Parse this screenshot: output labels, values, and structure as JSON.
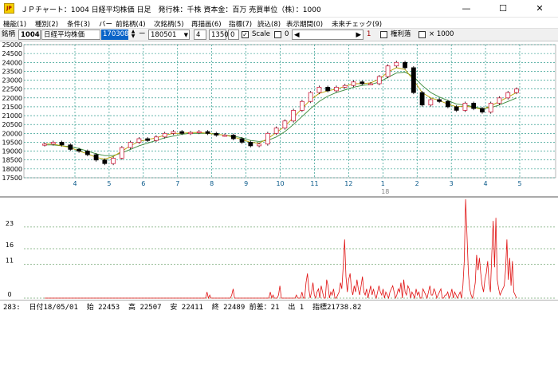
{
  "window": {
    "icon_text": "JP",
    "title": "ＪＰチャート：1004 日経平均株価 日足　発行株：千株 資本金：百万 売買単位（株）：1000",
    "min_glyph": "—",
    "max_glyph": "☐",
    "close_glyph": "✕"
  },
  "menu": [
    {
      "label": "機能(1)"
    },
    {
      "label": "種別(2)"
    },
    {
      "label": "条件(3)"
    },
    {
      "label": "バー"
    },
    {
      "label": "前銘柄(4)"
    },
    {
      "label": "次銘柄(5)"
    },
    {
      "label": "再描画(6)"
    },
    {
      "label": "指標(7)"
    },
    {
      "label": "読込(8)"
    },
    {
      "label": "表示期間(0)"
    },
    {
      "label": "未来チェック(9)"
    }
  ],
  "toolbar": {
    "label_code": "銘柄",
    "code_value": "1004",
    "name_value": "日経平均株価",
    "date_value": "170308",
    "dash": "ー",
    "end_date_value": "180501",
    "period_value": "4",
    "count_value": "1350",
    "zero_value": "0",
    "scale_label": "Scale",
    "scale_value": "0",
    "page_value": "1",
    "dividend_label": "権利落",
    "multiplier_label": "× 1000"
  },
  "chart_data": {
    "type": "candlestick",
    "price_axis": {
      "ticks": [
        25000,
        24500,
        24000,
        23500,
        23000,
        22500,
        22000,
        21500,
        21000,
        20500,
        20000,
        19500,
        19000,
        18500,
        18000,
        17500
      ],
      "range": [
        17500,
        25000
      ]
    },
    "months": [
      "4",
      "5",
      "6",
      "7",
      "8",
      "9",
      "10",
      "11",
      "12",
      "1",
      "2",
      "3",
      "4",
      "5"
    ],
    "year_label": "18",
    "close": [
      19400,
      19500,
      19350,
      19100,
      19000,
      18800,
      18500,
      18300,
      18600,
      19200,
      19500,
      19700,
      19600,
      19800,
      20000,
      20100,
      20000,
      20050,
      20100,
      20000,
      19900,
      19900,
      19700,
      19500,
      19300,
      19400,
      20000,
      20300,
      20700,
      21300,
      21800,
      22300,
      22600,
      22400,
      22600,
      22700,
      22900,
      22800,
      22800,
      23200,
      23800,
      24000,
      23700,
      22300,
      21600,
      21900,
      21800,
      21500,
      21300,
      21700,
      21400,
      21200,
      21700,
      22000,
      22300,
      22500
    ],
    "ma_short": [
      19400,
      19400,
      19300,
      19200,
      19000,
      18850,
      18650,
      18550,
      18700,
      19000,
      19300,
      19550,
      19650,
      19750,
      19900,
      20000,
      20000,
      20050,
      20050,
      20000,
      19950,
      19900,
      19800,
      19650,
      19500,
      19450,
      19700,
      20050,
      20400,
      20900,
      21400,
      21900,
      22250,
      22400,
      22500,
      22650,
      22800,
      22800,
      22850,
      23050,
      23450,
      23700,
      23600,
      23000,
      22300,
      22000,
      21850,
      21650,
      21500,
      21550,
      21450,
      21350,
      21550,
      21800,
      22050,
      22300
    ],
    "ma_long": [
      19350,
      19350,
      19300,
      19250,
      19150,
      19000,
      18850,
      18750,
      18750,
      18900,
      19100,
      19300,
      19450,
      19600,
      19750,
      19850,
      19950,
      20000,
      20000,
      20000,
      19950,
      19900,
      19850,
      19750,
      19600,
      19550,
      19600,
      19800,
      20100,
      20500,
      20950,
      21400,
      21800,
      22100,
      22300,
      22450,
      22600,
      22700,
      22750,
      22900,
      23150,
      23400,
      23450,
      23200,
      22700,
      22300,
      22050,
      21850,
      21650,
      21600,
      21500,
      21400,
      21450,
      21600,
      21800,
      22000
    ],
    "indicator_axis": {
      "ticks": [
        23,
        16,
        11,
        0
      ],
      "range": [
        0,
        32
      ]
    },
    "indicator": [
      0,
      0,
      0,
      0,
      0,
      0,
      0,
      0,
      0,
      0,
      0,
      0,
      0,
      0,
      0,
      0,
      0,
      0,
      0,
      0,
      0,
      0,
      0,
      0,
      0,
      0,
      0,
      0,
      0,
      0,
      0,
      0,
      0,
      0,
      0,
      0,
      0,
      0,
      0,
      0,
      0,
      0,
      0,
      0,
      0,
      0,
      0,
      0,
      0,
      0,
      0,
      0,
      0,
      0,
      0,
      0,
      0,
      0,
      0,
      0,
      0,
      0,
      0,
      0,
      0,
      0,
      0,
      0,
      0,
      0,
      0,
      0,
      0,
      0,
      0,
      0,
      0,
      0,
      0,
      0,
      0,
      0,
      0,
      0,
      0,
      0,
      0,
      0,
      0,
      0,
      0,
      0,
      0,
      0,
      0,
      0,
      0,
      0,
      0,
      0,
      0,
      0,
      0,
      0,
      0,
      0,
      0,
      0,
      0,
      0,
      0,
      0,
      0,
      0,
      0,
      0,
      0,
      0,
      2,
      0,
      1,
      0,
      0,
      0,
      0,
      0,
      0,
      0,
      0,
      0,
      0,
      0,
      0,
      0,
      0,
      0,
      1,
      3,
      0,
      0,
      0,
      0,
      0,
      0,
      0,
      0,
      0,
      0,
      0,
      0,
      0,
      0,
      0,
      0,
      0,
      0,
      0,
      0,
      0,
      0,
      0,
      0,
      0,
      0,
      2,
      0,
      1,
      0,
      0,
      0,
      1,
      4,
      0,
      0,
      0,
      0,
      0,
      0,
      0,
      0,
      0,
      0,
      0,
      1,
      0,
      0,
      0,
      2,
      0,
      0,
      5,
      8,
      3,
      0,
      2,
      5,
      1,
      0,
      2,
      3,
      0,
      4,
      2,
      0,
      0,
      6,
      4,
      0,
      2,
      1,
      3,
      0,
      0,
      1,
      2,
      5,
      3,
      10,
      19,
      7,
      2,
      6,
      8,
      3,
      1,
      4,
      2,
      6,
      3,
      1,
      4,
      7,
      2,
      1,
      3,
      0,
      2,
      4,
      1,
      3,
      1,
      0,
      2,
      4,
      2,
      1,
      3,
      0,
      2,
      1,
      0,
      2,
      3,
      4,
      2,
      0,
      1,
      3,
      2,
      5,
      0,
      6,
      2,
      1,
      4,
      3,
      0,
      2,
      1,
      0,
      3,
      1,
      2,
      0,
      0,
      3,
      2,
      1,
      0,
      2,
      4,
      1,
      1,
      3,
      2,
      0,
      1,
      2,
      3,
      0,
      0,
      1,
      1,
      2,
      0,
      1,
      3,
      0,
      2,
      1,
      0,
      1,
      2,
      0,
      4,
      12,
      32,
      20,
      8,
      3,
      1,
      0,
      2,
      5,
      14,
      9,
      13,
      8,
      4,
      2,
      6,
      8,
      12,
      5,
      2,
      14,
      25,
      10,
      26,
      6,
      3,
      1,
      2,
      3,
      4,
      9,
      19,
      6,
      13,
      4,
      12,
      2,
      1,
      0
    ],
    "status": {
      "text": "283:  日付18/05/01  始 22453  高 22507  安 22411  終 22489 前差：21  出 1  指標21738.82"
    }
  }
}
